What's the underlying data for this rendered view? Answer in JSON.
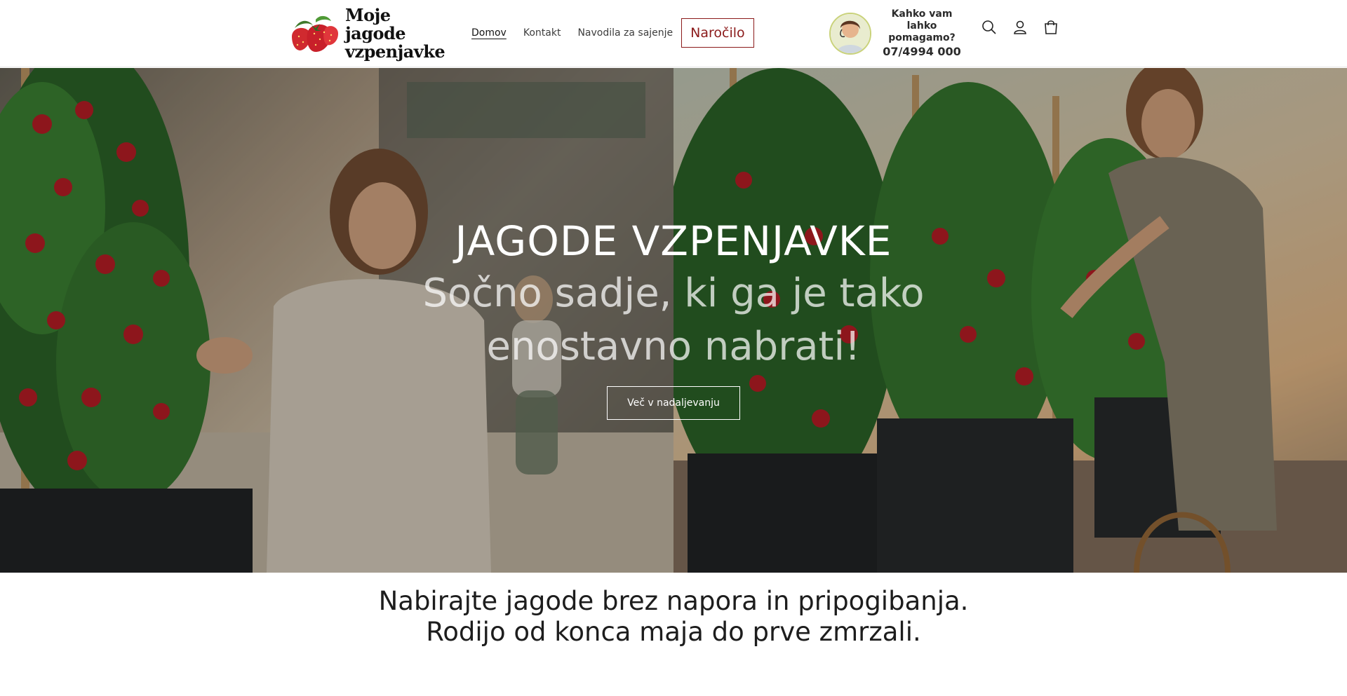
{
  "header": {
    "logo": {
      "line1": "Moje jagode",
      "line2": "vzpenjavke"
    },
    "nav": [
      {
        "label": "Domov",
        "active": true
      },
      {
        "label": "Kontakt",
        "active": false
      },
      {
        "label": "Navodila za sajenje",
        "active": false
      }
    ],
    "order_button": "Naročilo",
    "help": {
      "question": "Kahko vam lahko pomagamo?",
      "phone": "07/4994 000"
    },
    "icons": [
      "search-icon",
      "account-icon",
      "cart-icon"
    ]
  },
  "hero": {
    "title": "JAGODE VZPENJAVKE",
    "subtitle": "Sočno sadje, ki ga je tako enostavno nabrati!",
    "button": "Več v nadaljevanju"
  },
  "intro": {
    "line1": "Nabirajte jagode brez napora in pripogibanja.",
    "line2": "Rodijo od konca maja do prve zmrzali."
  },
  "colors": {
    "order_accent": "#8b1a1a",
    "strawberry": "#c8202a",
    "leaf": "#3f7a2c"
  }
}
